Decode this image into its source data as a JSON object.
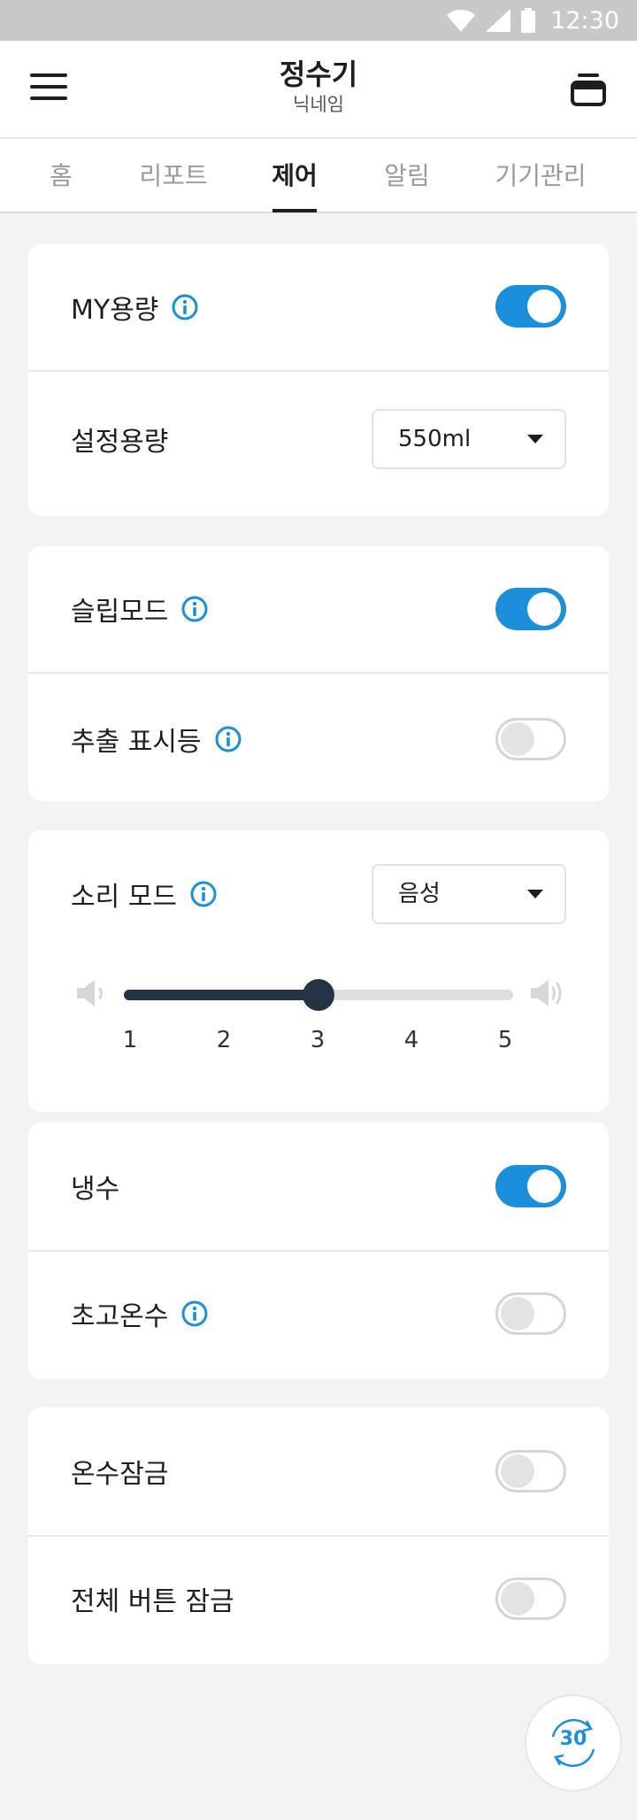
{
  "status_bar": {
    "time": "12:30"
  },
  "header": {
    "title": "정수기",
    "subtitle": "닉네임"
  },
  "tabs": [
    {
      "label": "홈"
    },
    {
      "label": "리포트"
    },
    {
      "label": "제어"
    },
    {
      "label": "알림"
    },
    {
      "label": "기기관리"
    }
  ],
  "active_tab": "제어",
  "my_volume": {
    "label": "MY용량",
    "enabled": true
  },
  "set_volume": {
    "label": "설정용량",
    "value": "550ml"
  },
  "sleep_mode": {
    "label": "슬립모드",
    "enabled": true
  },
  "dispense_light": {
    "label": "추출 표시등",
    "enabled": false
  },
  "sound_mode": {
    "label": "소리 모드",
    "value": "음성",
    "volume_level": 3,
    "volume_ticks": [
      "1",
      "2",
      "3",
      "4",
      "5"
    ]
  },
  "cold_water": {
    "label": "냉수",
    "enabled": true
  },
  "extra_hot_water": {
    "label": "초고온수",
    "enabled": false
  },
  "hot_water_lock": {
    "label": "온수잠금",
    "enabled": false
  },
  "all_buttons_lock": {
    "label": "전체 버튼 잠금",
    "enabled": false
  },
  "timer": {
    "value": "30"
  },
  "colors": {
    "accent": "#1b8fd9",
    "dark": "#243445",
    "background": "#f3f3f3"
  }
}
